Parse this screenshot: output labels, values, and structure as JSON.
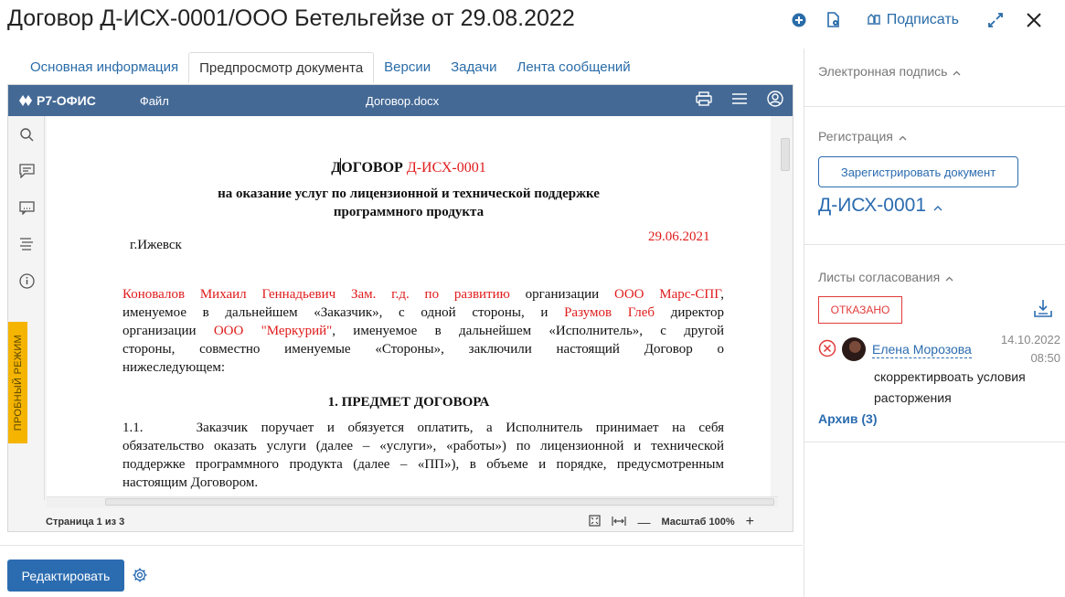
{
  "header": {
    "title": "Договор Д-ИСХ-0001/ООО Бетельгейзе от 29.08.2022",
    "sign_label": "Подписать",
    "icons": [
      "plus-circle-icon",
      "document-settings-icon",
      "sign-icon",
      "expand-icon",
      "close-icon"
    ]
  },
  "tabs": [
    {
      "label": "Основная информация"
    },
    {
      "label": "Предпросмотр документа",
      "active": true
    },
    {
      "label": "Версии"
    },
    {
      "label": "Задачи"
    },
    {
      "label": "Лента сообщений"
    }
  ],
  "editor": {
    "logo": "Р7-ОФИС",
    "menu_file": "Файл",
    "filename": "Договор.docx",
    "trial_label": "ПРОБНЫЙ РЕЖИМ",
    "status_page": "Страница 1 из 3",
    "zoom_label": "Масштаб 100%",
    "left_tools": [
      "search-icon",
      "comment-icon",
      "chat-icon",
      "align-icon",
      "info-icon"
    ]
  },
  "document": {
    "title_prefix": "ДОГОВОР ",
    "title_number": "Д-ИСХ-0001",
    "subtitle1": "на оказание услуг по лицензионной и технической поддержке",
    "subtitle2": "программного продукта",
    "city": "г.Ижевск",
    "date": "29.06.2021",
    "para1_l1_a": "Коновалов Михаил Геннадьевич Зам. г.д. по развитию",
    "para1_l1_b": " организации ",
    "para1_l1_c": "ООО Марс-СПГ",
    "para1_l1_d": ",",
    "para1_l2_a": "именуемое в дальнейшем «Заказчик», с одной стороны, и ",
    "para1_l2_b": "Разумов Глеб",
    "para1_l2_c": " директор",
    "para1_l3_a": "организации ",
    "para1_l3_b": "ООО \"Меркурий\"",
    "para1_l3_c": ", именуемое в дальнейшем «Исполнитель», с другой",
    "para1_l4": "стороны, совместно именуемые «Стороны», заключили настоящий Договор о",
    "para1_l5": "нижеследующем:",
    "section1": "1. ПРЕДМЕТ ДОГОВОРА",
    "para2_l1": "1.1.    Заказчик поручает и обязуется оплатить, а Исполнитель принимает на себя",
    "para2_l2": "обязательство оказать услуги (далее – «услуги», «работы») по лицензионной и технической",
    "para2_l3": "поддержке программного продукта (далее – «ПП»), в объеме и порядке, предусмотренным",
    "para2_l4": "настоящим Договором."
  },
  "footer": {
    "edit_label": "Редактировать"
  },
  "right_panel": {
    "signature_title": "Электронная подпись",
    "registration_title": "Регистрация",
    "register_button": "Зарегистрировать документ",
    "reg_number": "Д-ИСХ-0001",
    "approval_title": "Листы согласования",
    "status_badge": "ОТКАЗАНО",
    "approver_name": "Елена Морозова",
    "approval_date": "14.10.2022",
    "approval_time": "08:50",
    "comment": "скорректирвоать условия расторжения",
    "archive_label": "Архив (3)"
  },
  "colors": {
    "accent": "#2b6cb0",
    "editor_bar": "#446995",
    "doc_highlight": "#e01b1b",
    "trial_badge": "#f5b400",
    "rejected": "#e23b3b"
  }
}
